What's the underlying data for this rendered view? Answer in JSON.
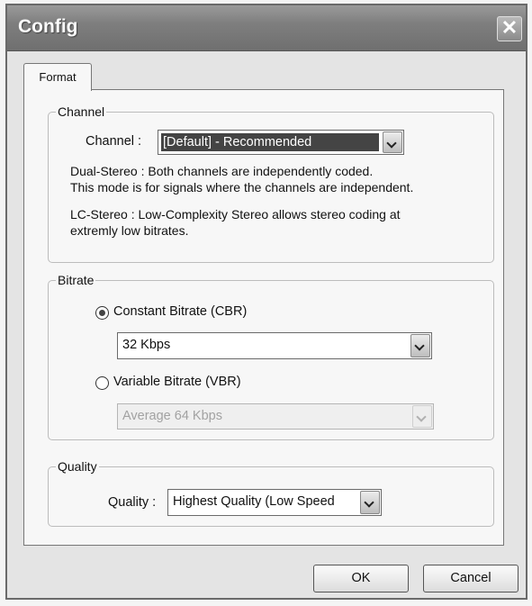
{
  "window": {
    "title": "Config",
    "close_glyph": "✕"
  },
  "tabs": [
    {
      "label": "Format"
    }
  ],
  "channel_group": {
    "legend": "Channel",
    "field_label": "Channel :",
    "select_value": "[Default] - Recommended",
    "desc1_line1": "Dual-Stereo : Both channels are independently coded.",
    "desc1_line2": "This mode is for signals where the channels are independent.",
    "desc2_line1": "LC-Stereo : Low-Complexity Stereo allows stereo coding at",
    "desc2_line2": "extremly low bitrates."
  },
  "bitrate_group": {
    "legend": "Bitrate",
    "cbr_label": "Constant Bitrate (CBR)",
    "cbr_selected": true,
    "cbr_value": "32 Kbps",
    "vbr_label": "Variable Bitrate (VBR)",
    "vbr_selected": false,
    "vbr_value": "Average 64 Kbps"
  },
  "quality_group": {
    "legend": "Quality",
    "field_label": "Quality :",
    "select_value": "Highest Quality (Low Speed"
  },
  "buttons": {
    "ok": "OK",
    "cancel": "Cancel"
  }
}
